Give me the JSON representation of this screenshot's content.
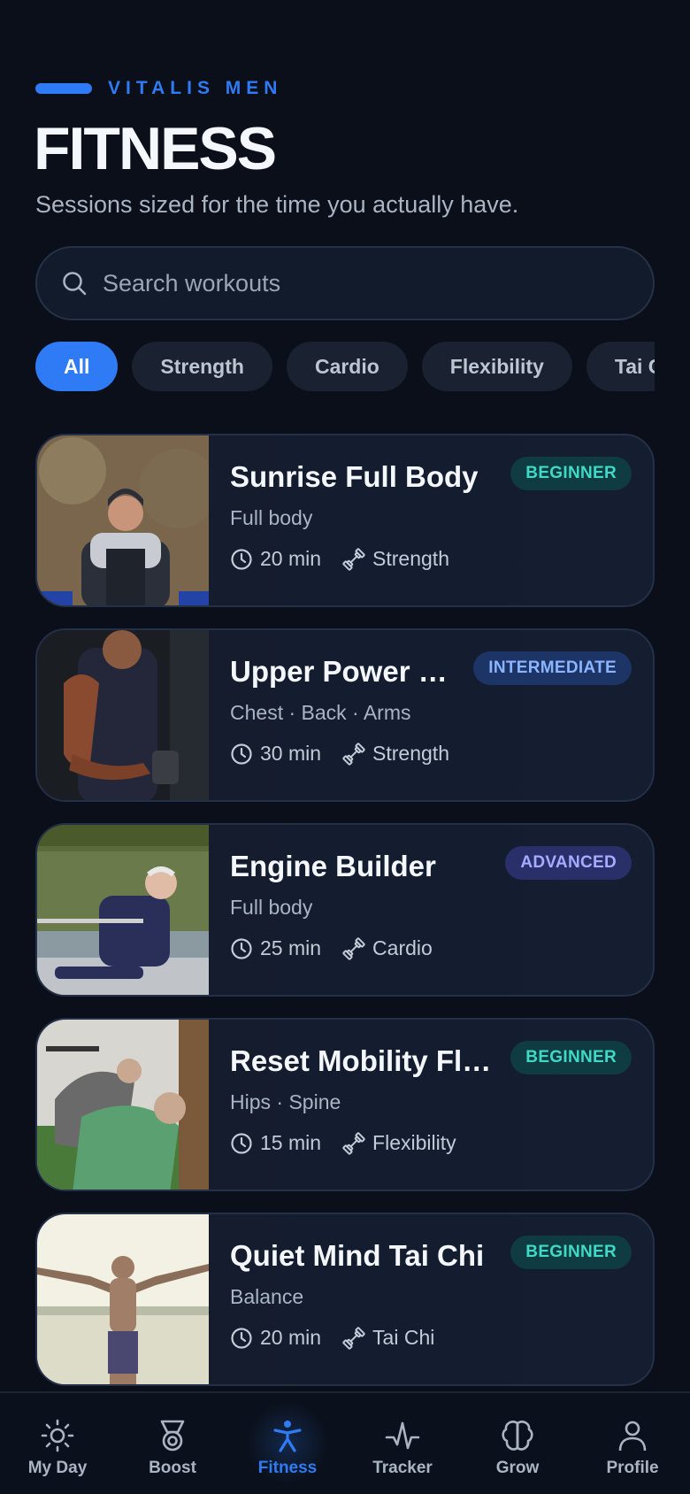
{
  "header": {
    "eyebrow": "VITALIS MEN",
    "title": "FITNESS",
    "subtitle": "Sessions sized for the time you actually have."
  },
  "search": {
    "placeholder": "Search workouts",
    "value": ""
  },
  "filters": [
    "All",
    "Strength",
    "Cardio",
    "Flexibility",
    "Tai Chi"
  ],
  "active_filter": "All",
  "workouts": [
    {
      "title": "Sunrise Full Body",
      "subtitle": "Full body",
      "duration": "20 min",
      "category": "Strength",
      "level": "BEGINNER",
      "image": "man-smiling-dips-outdoors"
    },
    {
      "title": "Upper Power …",
      "subtitle": "Chest · Back · Arms",
      "duration": "30 min",
      "category": "Strength",
      "level": "INTERMEDIATE",
      "image": "muscular-man-dumbbell-curl"
    },
    {
      "title": "Engine Builder",
      "subtitle": "Full body",
      "duration": "25 min",
      "category": "Cardio",
      "level": "ADVANCED",
      "image": "older-man-rowing-boat"
    },
    {
      "title": "Reset Mobility Fl…",
      "subtitle": "Hips · Spine",
      "duration": "15 min",
      "category": "Flexibility",
      "level": "BEGINNER",
      "image": "men-stretching-gym"
    },
    {
      "title": "Quiet Mind Tai Chi",
      "subtitle": "Balance",
      "duration": "20 min",
      "category": "Tai Chi",
      "level": "BEGINNER",
      "image": "man-arms-outstretched-lake"
    }
  ],
  "nav": {
    "items": [
      {
        "label": "My Day",
        "icon": "sun-icon"
      },
      {
        "label": "Boost",
        "icon": "medal-icon"
      },
      {
        "label": "Fitness",
        "icon": "person-icon"
      },
      {
        "label": "Tracker",
        "icon": "pulse-icon"
      },
      {
        "label": "Grow",
        "icon": "brain-icon"
      },
      {
        "label": "Profile",
        "icon": "user-icon"
      }
    ],
    "active": "Fitness"
  },
  "colors": {
    "accent": "#2f7bf5",
    "background": "#0a0f1a",
    "card": "#131b2d"
  }
}
